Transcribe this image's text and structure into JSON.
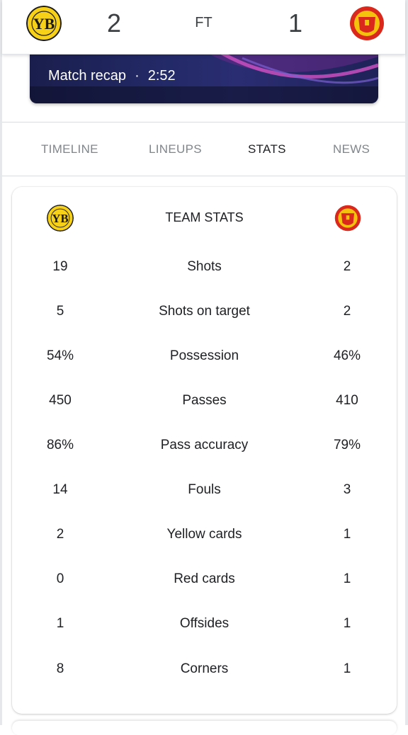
{
  "match": {
    "home_score": "2",
    "away_score": "1",
    "status": "FT",
    "home_crest_icon": "young-boys-crest",
    "away_crest_icon": "manchester-united-crest",
    "home_color": "#f7d117",
    "away_color": "#da291c"
  },
  "video": {
    "label": "Match recap",
    "separator": "·",
    "duration": "2:52"
  },
  "tabs": [
    {
      "label": "TIMELINE",
      "active": false
    },
    {
      "label": "LINEUPS",
      "active": false
    },
    {
      "label": "STATS",
      "active": true
    },
    {
      "label": "NEWS",
      "active": false
    }
  ],
  "team_stats": {
    "title": "TEAM STATS",
    "rows": [
      {
        "label": "Shots",
        "home": "19",
        "away": "2"
      },
      {
        "label": "Shots on target",
        "home": "5",
        "away": "2"
      },
      {
        "label": "Possession",
        "home": "54%",
        "away": "46%"
      },
      {
        "label": "Passes",
        "home": "450",
        "away": "410"
      },
      {
        "label": "Pass accuracy",
        "home": "86%",
        "away": "79%"
      },
      {
        "label": "Fouls",
        "home": "14",
        "away": "3"
      },
      {
        "label": "Yellow cards",
        "home": "2",
        "away": "1"
      },
      {
        "label": "Red cards",
        "home": "0",
        "away": "1"
      },
      {
        "label": "Offsides",
        "home": "1",
        "away": "1"
      },
      {
        "label": "Corners",
        "home": "8",
        "away": "1"
      }
    ]
  }
}
